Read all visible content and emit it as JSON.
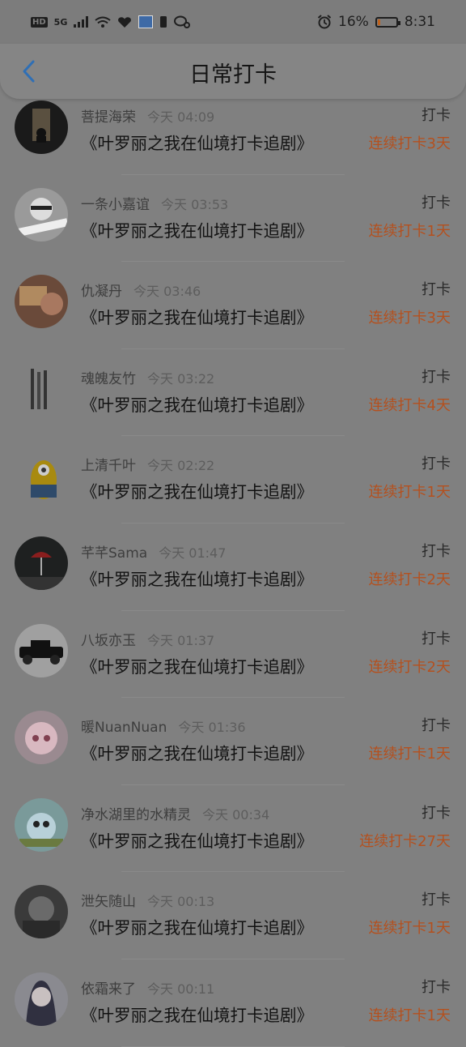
{
  "status_bar": {
    "hd": "HD",
    "network": "5G",
    "battery_percent": "16%",
    "battery_level": 0.16,
    "time": "8:31"
  },
  "header": {
    "title": "日常打卡"
  },
  "colors": {
    "streak": "#b4501e",
    "accent_back": "#2f6fb5"
  },
  "items": [
    {
      "name": "菩提海荣",
      "time": "今天 04:09",
      "topic": "《叶罗丽之我在仙境打卡追剧》",
      "kind": "打卡",
      "streak": "连续打卡3天"
    },
    {
      "name": "一条小嘉谊",
      "time": "今天 03:53",
      "topic": "《叶罗丽之我在仙境打卡追剧》",
      "kind": "打卡",
      "streak": "连续打卡1天"
    },
    {
      "name": "仇凝丹",
      "time": "今天 03:46",
      "topic": "《叶罗丽之我在仙境打卡追剧》",
      "kind": "打卡",
      "streak": "连续打卡3天"
    },
    {
      "name": "魂魄友竹",
      "time": "今天 03:22",
      "topic": "《叶罗丽之我在仙境打卡追剧》",
      "kind": "打卡",
      "streak": "连续打卡4天"
    },
    {
      "name": "上清千叶",
      "time": "今天 02:22",
      "topic": "《叶罗丽之我在仙境打卡追剧》",
      "kind": "打卡",
      "streak": "连续打卡1天"
    },
    {
      "name": "芊芊Sama",
      "time": "今天 01:47",
      "topic": "《叶罗丽之我在仙境打卡追剧》",
      "kind": "打卡",
      "streak": "连续打卡2天"
    },
    {
      "name": "八坂亦玉",
      "time": "今天 01:37",
      "topic": "《叶罗丽之我在仙境打卡追剧》",
      "kind": "打卡",
      "streak": "连续打卡2天"
    },
    {
      "name": "暖NuanNuan",
      "time": "今天 01:36",
      "topic": "《叶罗丽之我在仙境打卡追剧》",
      "kind": "打卡",
      "streak": "连续打卡1天"
    },
    {
      "name": "净水湖里的水精灵",
      "time": "今天 00:34",
      "topic": "《叶罗丽之我在仙境打卡追剧》",
      "kind": "打卡",
      "streak": "连续打卡27天"
    },
    {
      "name": "泄矢随山",
      "time": "今天 00:13",
      "topic": "《叶罗丽之我在仙境打卡追剧》",
      "kind": "打卡",
      "streak": "连续打卡1天"
    },
    {
      "name": "依霜来了",
      "time": "今天 00:11",
      "topic": "《叶罗丽之我在仙境打卡追剧》",
      "kind": "打卡",
      "streak": "连续打卡1天"
    }
  ]
}
